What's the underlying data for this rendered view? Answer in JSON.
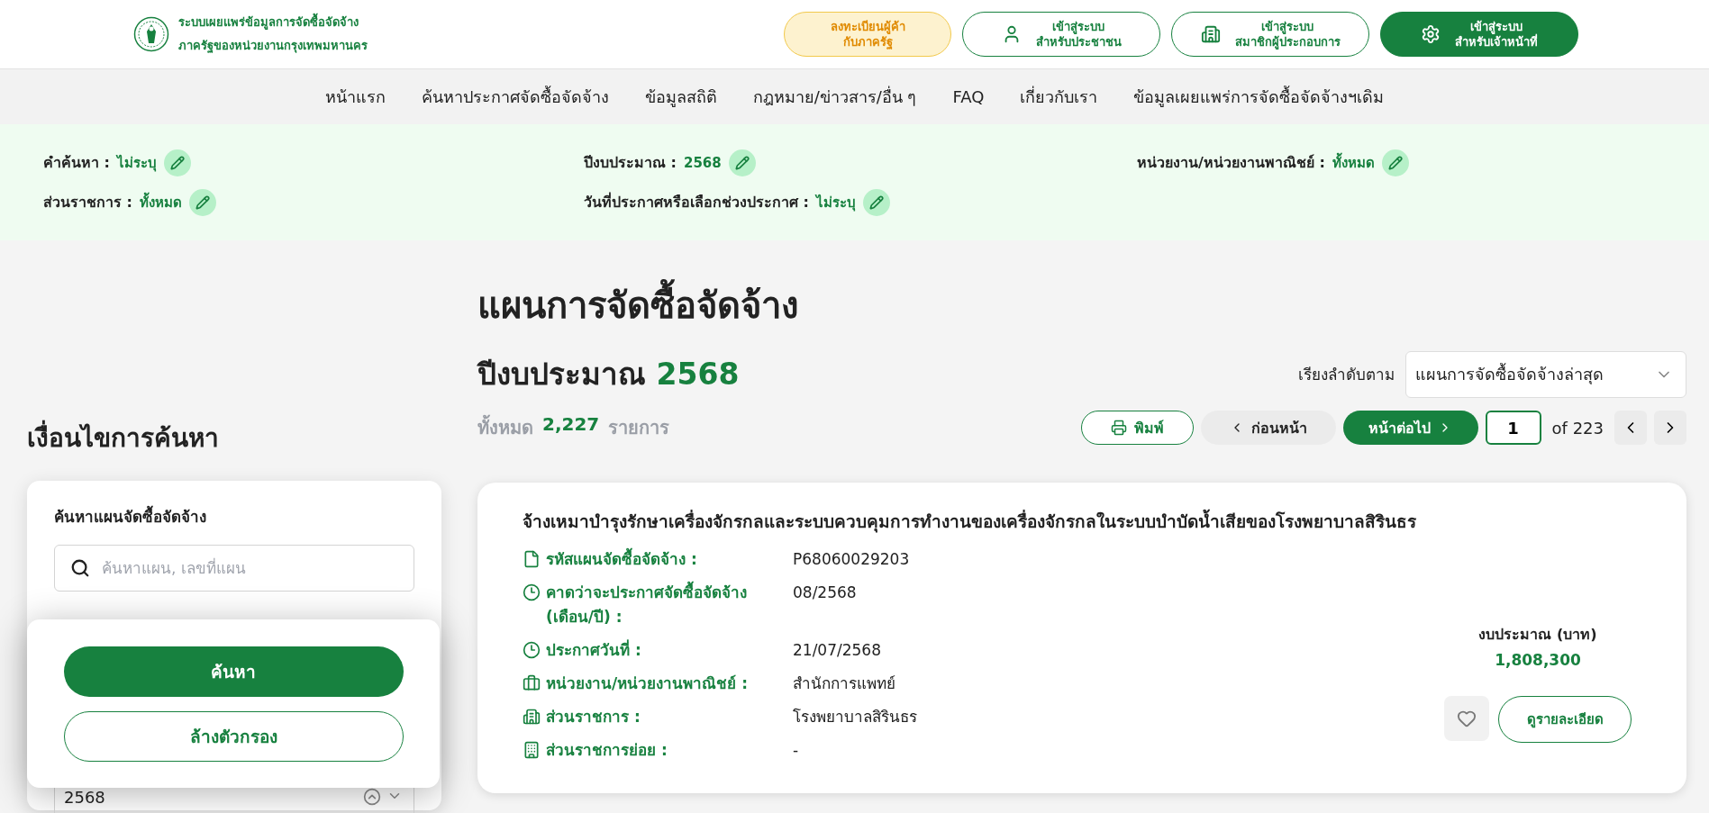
{
  "header": {
    "title_lines": [
      "ระบบเผยแพร่ข้อมูลการจัดซื้อจัดจ้าง",
      "ภาครัฐของหน่วยงานกรุงเทพมหานคร"
    ],
    "buttons": [
      {
        "kind": "register",
        "lines": [
          "ลงทะเบียนผู้ค้า",
          "กับภาครัฐ"
        ]
      },
      {
        "kind": "citizen",
        "lines": [
          "เข้าสู่ระบบ",
          "สำหรับประชาชน"
        ]
      },
      {
        "kind": "member",
        "lines": [
          "เข้าสู่ระบบ",
          "สมาชิกผู้ประกอบการ"
        ]
      },
      {
        "kind": "officer",
        "lines": [
          "เข้าสู่ระบบ",
          "สำหรับเจ้าหน้าที่"
        ]
      }
    ]
  },
  "nav": [
    "หน้าแรก",
    "ค้นหาประกาศจัดซื้อจัดจ้าง",
    "ข้อมูลสถิติ",
    "กฎหมาย/ข่าวสาร/อื่น ๆ",
    "FAQ",
    "เกี่ยวกับเรา",
    "ข้อมูลเผยแพร่การจัดซื้อจัดจ้างฯเดิม"
  ],
  "filters": [
    {
      "label": "คำค้นหา :",
      "value": "ไม่ระบุ"
    },
    {
      "label": "ปีงบประมาณ :",
      "value": "2568"
    },
    {
      "label": "หน่วยงาน/หน่วยงานพาณิชย์ :",
      "value": "ทั้งหมด"
    },
    {
      "label": "ส่วนราชการ :",
      "value": "ทั้งหมด"
    },
    {
      "label": "วันที่ประกาศหรือเลือกช่วงประกาศ :",
      "value": "ไม่ระบุ"
    }
  ],
  "sidebar": {
    "heading": "เงื่อนไขการค้นหา",
    "search_label": "ค้นหาแผนจัดซื้อจัดจ้าง",
    "search_placeholder": "ค้นหาแผน, เลขที่แผน",
    "year_value": "2568",
    "search_button": "ค้นหา",
    "clear_button": "ล้างตัวกรอง"
  },
  "main": {
    "title": "แผนการจัดซื้อจัดจ้าง",
    "year_label": "ปีงบประมาณ",
    "year": "2568",
    "sort_label": "เรียงลำดับตาม",
    "sort_value": "แผนการจัดซื้อจัดจ้างล่าสุด",
    "total_label": "ทั้งหมด",
    "total": "2,227",
    "total_unit": "รายการ",
    "print": "พิมพ์",
    "prev": "ก่อนหน้า",
    "next": "หน้าต่อไป",
    "page": "1",
    "of": "of",
    "pages": "223"
  },
  "results": [
    {
      "title": "จ้างเหมาบำรุงรักษาเครื่องจักรกลและระบบควบคุมการทำงานของเครื่องจักรกลในระบบบำบัดน้ำเสียของโรงพยาบาลสิรินธร",
      "details": [
        {
          "kind": "file",
          "label": "รหัสแผนจัดซื้อจัดจ้าง :",
          "value": "P68060029203"
        },
        {
          "kind": "clock",
          "label": "คาดว่าจะประกาศจัดซื้อจัดจ้าง (เดือน/ปี) :",
          "value": "08/2568"
        },
        {
          "kind": "clock",
          "label": "ประกาศวันที่ :",
          "value": "21/07/2568"
        },
        {
          "kind": "briefcase",
          "label": "หน่วยงาน/หน่วยงานพาณิชย์ :",
          "value": "สำนักการแพทย์"
        },
        {
          "kind": "buildings",
          "label": "ส่วนราชการ :",
          "value": "โรงพยาบาลสิรินธร"
        },
        {
          "kind": "building",
          "label": "ส่วนราชการย่อย :",
          "value": "-"
        }
      ],
      "budget_label": "งบประมาณ (บาท)",
      "budget": "1,808,300",
      "favorite": false,
      "details_button": "ดูรายละเอียด"
    }
  ]
}
